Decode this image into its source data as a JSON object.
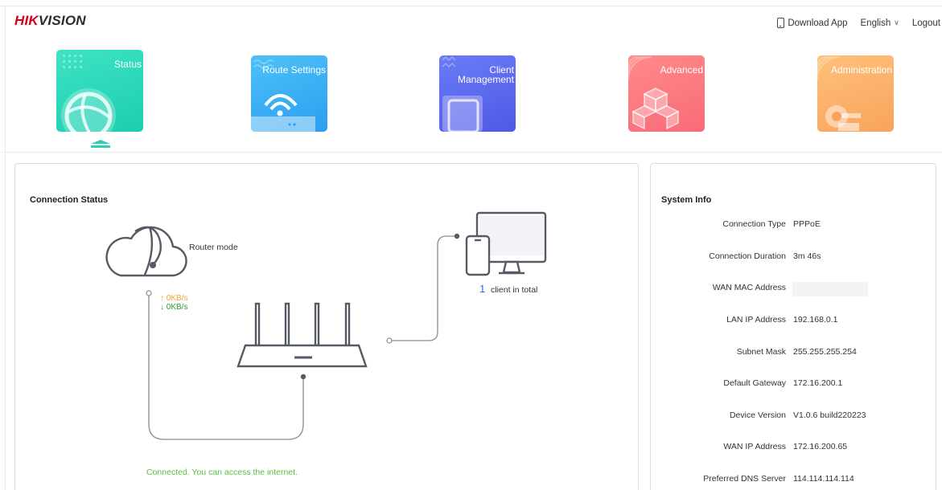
{
  "header": {
    "logo_red": "HIK",
    "logo_dark": "VISION",
    "download_app": "Download App",
    "language": "English",
    "logout": "Logout"
  },
  "nav": {
    "tiles": [
      {
        "label": "Status",
        "active": true
      },
      {
        "label": "Route Settings"
      },
      {
        "label": "Client\nManagement",
        "label_line1": "Client",
        "label_line2": "Management"
      },
      {
        "label": "Advanced"
      },
      {
        "label": "Administration"
      }
    ]
  },
  "connection": {
    "title": "Connection Status",
    "mode": "Router mode",
    "upload": "↑ 0KB/s",
    "download": "↓ 0KB/s",
    "client_count": "1",
    "client_text": "client in total",
    "status_message": "Connected. You can access the internet."
  },
  "system": {
    "title": "System Info",
    "rows": [
      {
        "key": "Connection Type",
        "value": "PPPoE"
      },
      {
        "key": "Connection Duration",
        "value": "3m 46s"
      },
      {
        "key": "WAN MAC Address",
        "value": ""
      },
      {
        "key": "LAN IP Address",
        "value": "192.168.0.1"
      },
      {
        "key": "Subnet Mask",
        "value": "255.255.255.254"
      },
      {
        "key": "Default Gateway",
        "value": "172.16.200.1"
      },
      {
        "key": "Device Version",
        "value": "V1.0.6 build220223"
      },
      {
        "key": "WAN IP Address",
        "value": "172.16.200.65"
      },
      {
        "key": "Preferred DNS Server",
        "value": "114.114.114.114"
      }
    ]
  },
  "colors": {
    "brand": "#d4001a",
    "status_tile": "#1ccdb0",
    "route_tile": "#2a9ff0",
    "client_tile": "#4f58e6",
    "advanced_tile": "#f86b78",
    "admin_tile": "#f8a45c",
    "upload": "#f5a623",
    "download": "#2e9d2e",
    "connected": "#5bbd3d",
    "client_count": "#1e6cff"
  }
}
